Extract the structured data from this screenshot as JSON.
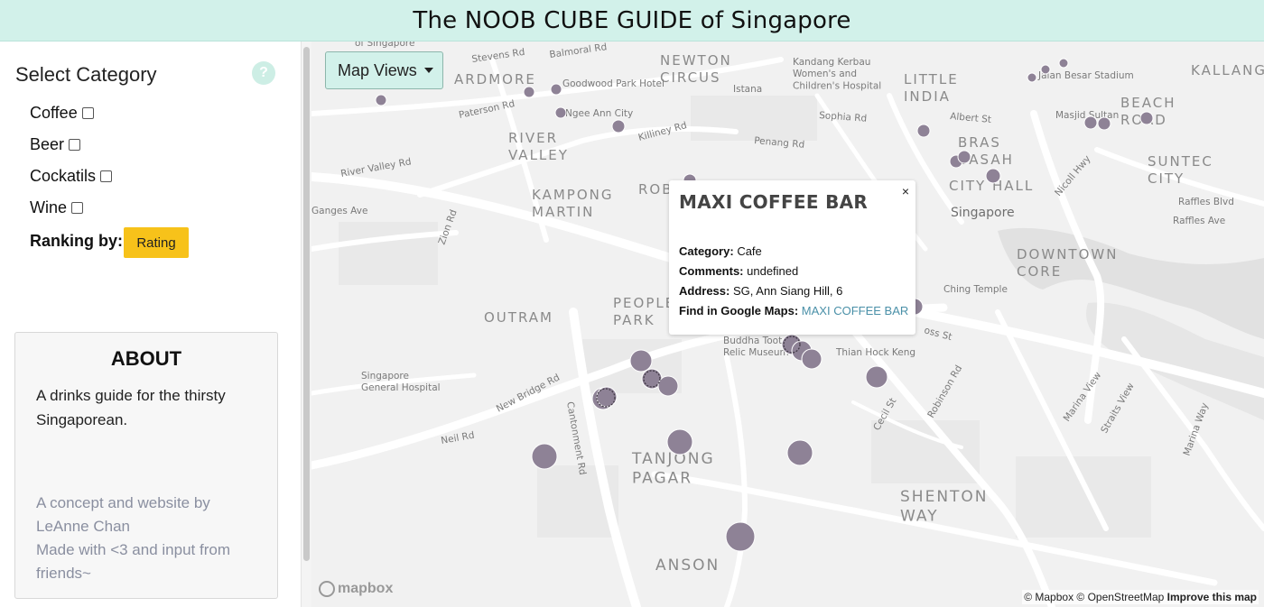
{
  "header": {
    "title": "The NOOB CUBE GUIDE of Singapore"
  },
  "sidebar": {
    "select_title": "Select Category",
    "help_icon": "?",
    "categories": [
      {
        "label": "Coffee",
        "checked": false
      },
      {
        "label": "Beer",
        "checked": false
      },
      {
        "label": "Cockatils",
        "checked": false
      },
      {
        "label": "Wine",
        "checked": false
      }
    ],
    "ranking_label": "Ranking by:",
    "ranking_button": "Rating",
    "about": {
      "title": "ABOUT",
      "text": "A drinks guide for the thirsty Singaporean.",
      "credit_1": "A concept and website by LeAnne Chan",
      "credit_2": "Made with <3 and input from friends~"
    }
  },
  "map": {
    "views_button": "Map Views",
    "marker_color": "#8e8296",
    "labels": {
      "ardmore": "ARDMORE",
      "newton_circus": "NEWTON\nCIRCUS",
      "little_india": "LITTLE\nINDIA",
      "kallang": "KALLANG",
      "beach_road": "BEACH\nROAD",
      "river_valley": "RIVER\nVALLEY",
      "bras_basah": "BRAS\nBASAH",
      "suntec_city": "SUNTEC\nCITY",
      "kampong_martin": "KAMPONG\nMARTIN",
      "city_hall": "CITY HALL",
      "singapore": "Singapore",
      "downtown_core": "DOWNTOWN\nCORE",
      "outram": "OUTRAM",
      "people_park": "PEOPLE\nPARK",
      "tanjong_pagar": "TANJONG\nPAGAR",
      "shenton_way": "SHENTON\nWAY",
      "anson": "ANSON",
      "rob": "ROB",
      "stevens_rd": "Stevens Rd",
      "balmoral_rd": "Balmoral Rd",
      "goodwood": "Goodwood Park Hotel",
      "paterson_rd": "Paterson Rd",
      "ngee_ann": "Ngee Ann City",
      "killiney_rd": "Killiney Rd",
      "penang_rd": "Penang Rd",
      "istana": "Istana",
      "kk_hospital": "Kandang Kerbau\nWomen's and\nChildren's Hospital",
      "sophia_rd": "Sophia Rd",
      "albert_st": "Albert St",
      "jalan_besar": "Jalan Besar Stadium",
      "masjid_sultan": "Masjid Sultan",
      "river_valley_rd": "River Valley Rd",
      "ganges_ave": "Ganges Ave",
      "zion_rd": "Zion Rd",
      "nicoll_hwy": "Nicoll Hwy",
      "raffles_blvd": "Raffles Blvd",
      "raffles_ave": "Raffles Ave",
      "ching_temple": "Ching Temple",
      "oss_st": "oss St",
      "buddha_tooth": "Buddha Toot\nRelic Museum",
      "thian_hock_keng": "Thian Hock Keng",
      "robinson_rd": "Robinson Rd",
      "cecil_st": "Cecil St",
      "marina_view": "Marina View",
      "straits_view": "Straits View",
      "marina_way": "Marina Way",
      "sgh": "Singapore\nGeneral Hospital",
      "new_bridge_rd": "New Bridge Rd",
      "neil_rd": "Neil Rd",
      "cantonment_rd": "Cantonment Rd",
      "of_singapore": "of Singapore"
    },
    "popup": {
      "title": "MAXI COFFEE BAR",
      "close": "×",
      "category_label": "Category:",
      "category_value": "Cafe",
      "comments_label": "Comments:",
      "comments_value": "undefined",
      "address_label": "Address:",
      "address_value": "SG, Ann Siang Hill, 6",
      "maps_label": "Find in Google Maps:",
      "maps_value": "MAXI COFFEE BAR"
    },
    "logo": "mapbox",
    "attribution": "© Mapbox © OpenStreetMap",
    "improve": "Improve this map"
  }
}
